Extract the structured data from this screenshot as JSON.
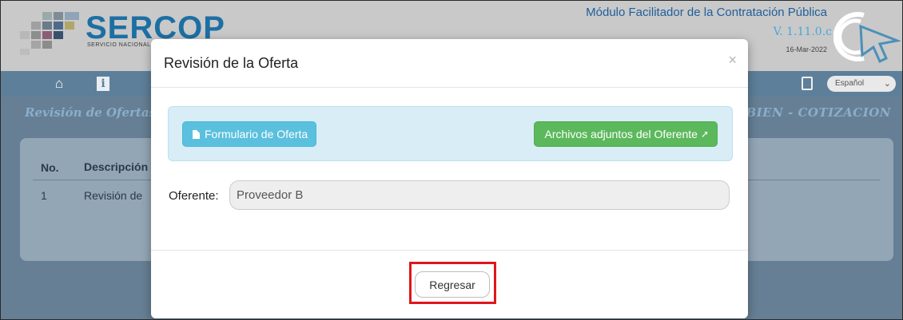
{
  "header": {
    "logo_text": "SERCOP",
    "logo_subtitle": "SERVICIO NACIONAL D",
    "module_title": "Módulo Facilitador de la Contratación Pública",
    "version": "V. 1.11.0.c",
    "date": "16-Mar-2022"
  },
  "navbar": {
    "icons": [
      "home-icon",
      "info-icon"
    ],
    "language": "Español"
  },
  "subbar": {
    "left_title": "Revisión de Ofertas",
    "right_title": "BIEN - COTIZACION"
  },
  "table": {
    "headers": [
      "No.",
      "Descripción"
    ],
    "rows": [
      [
        "1",
        "Revisión de"
      ]
    ]
  },
  "modal": {
    "title": "Revisión de la Oferta",
    "close_symbol": "×",
    "buttons": {
      "form_label": "Formulario de Oferta",
      "attachments_label": "Archivos adjuntos del Oferente"
    },
    "oferente_label": "Oferente:",
    "oferente_value": "Proveedor B",
    "back_label": "Regresar"
  },
  "colors": {
    "info_button": "#5bc0de",
    "success_button": "#5cb85c",
    "highlight": "#e0161b",
    "brand_blue": "#1d6fa3"
  }
}
